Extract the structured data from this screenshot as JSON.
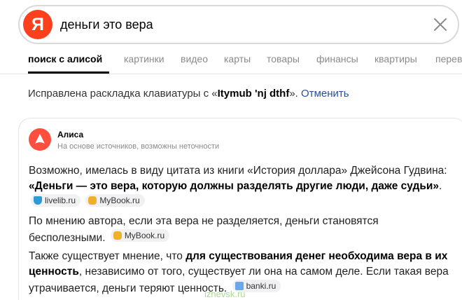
{
  "search": {
    "logo_letter": "Я",
    "query": "деньги это вера"
  },
  "tabs": [
    {
      "label": "поиск с алисой",
      "active": true
    },
    {
      "label": "картинки"
    },
    {
      "label": "видео"
    },
    {
      "label": "карты"
    },
    {
      "label": "товары"
    },
    {
      "label": "финансы"
    },
    {
      "label": "квартиры"
    },
    {
      "label": "перев"
    }
  ],
  "fix_note": {
    "prefix": "Исправлена раскладка клавиатуры с «",
    "original": "Itymub 'nj dthf",
    "suffix": "». ",
    "undo": "Отменить"
  },
  "alisa": {
    "name": "Алиса",
    "subtitle": "На основе источников, возможны неточности",
    "p1_text": "Возможно, имелась в виду цитата из книги «История доллара» Джейсона Гудвина: ",
    "p1_bold": "«Деньги — это вера, которую должны разделять другие люди, даже судьи»",
    "p1_end": ".",
    "p1_sources": [
      "livelib.ru",
      "MyBook.ru"
    ],
    "p2_text": "По мнению автора, если эта вера не разделяется, деньги становятся бесполезными.",
    "p2_sources": [
      "MyBook.ru"
    ],
    "p3_text1": "Также существует мнение, что ",
    "p3_bold": "для существования денег необходима вера в их ценность",
    "p3_text2": ", независимо от того, существует ли она на самом деле. Если такая вера утрачивается, деньги теряют ценность.",
    "p3_sources": [
      "banki.ru"
    ]
  },
  "watermark": "izhevsk.ru",
  "colors": {
    "brand": "#fc3f1d",
    "link": "#2a50a0",
    "alisa": "#ff4e3d"
  }
}
